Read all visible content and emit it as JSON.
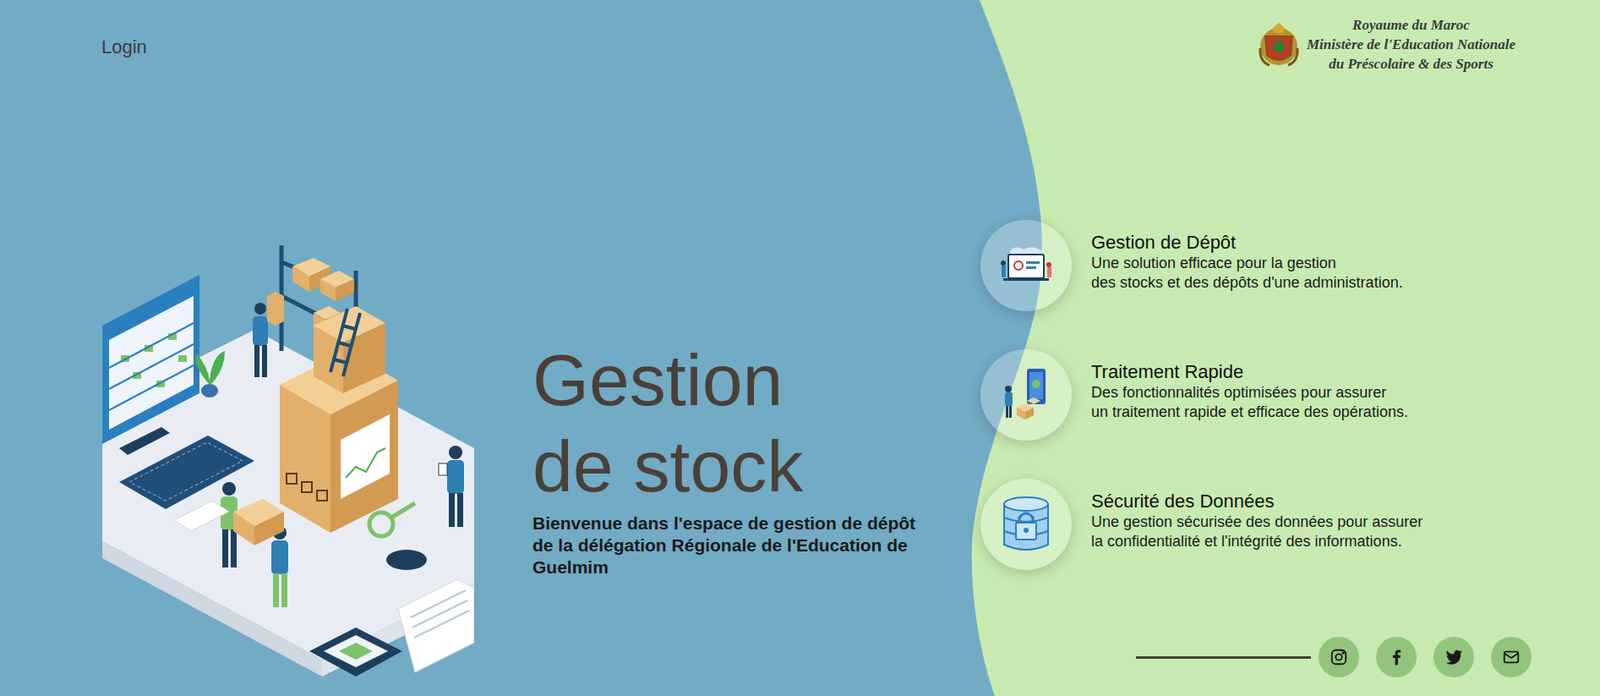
{
  "header": {
    "login": "Login"
  },
  "logo": {
    "lines": [
      "Royaume du Maroc",
      "Ministère de l'Education Nationale",
      "du Préscolaire & des Sports"
    ]
  },
  "hero": {
    "title_lines": [
      "Gestion",
      "de stock"
    ],
    "subtitle_lines": [
      "Bienvenue dans l'espace de gestion de dépôt",
      "de la délégation Régionale de l'Education de",
      "Guelmim"
    ]
  },
  "features": [
    {
      "kind": "depot",
      "title": "Gestion de Dépôt",
      "description_lines": [
        "Une solution efficace pour la gestion",
        "des stocks et des dépôts d'une administration."
      ]
    },
    {
      "kind": "rapide",
      "title": "Traitement Rapide",
      "description_lines": [
        "Des fonctionnalités optimisées pour assurer",
        "un traitement rapide et efficace des opérations."
      ]
    },
    {
      "kind": "securite",
      "title": "Sécurité des Données",
      "description_lines": [
        "Une gestion sécurisée des données pour assurer",
        "la confidentialité et l'intégrité des informations."
      ]
    }
  ],
  "social": [
    {
      "kind": "instagram"
    },
    {
      "kind": "facebook"
    },
    {
      "kind": "twitter"
    },
    {
      "kind": "email"
    }
  ]
}
